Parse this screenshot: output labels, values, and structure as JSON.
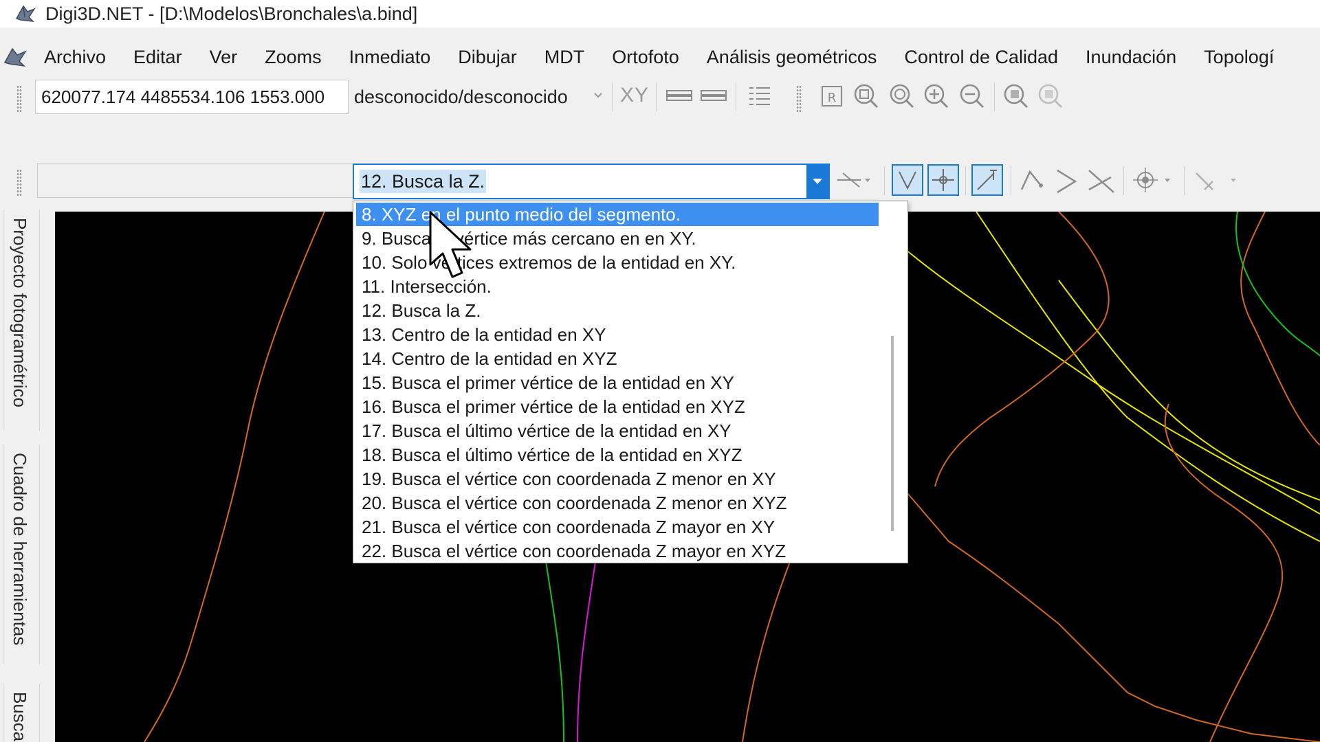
{
  "window": {
    "title": "Digi3D.NET - [D:\\Modelos\\Bronchales\\a.bind]"
  },
  "menu": {
    "items": [
      "Archivo",
      "Editar",
      "Ver",
      "Zooms",
      "Inmediato",
      "Dibujar",
      "MDT",
      "Ortofoto",
      "Análisis geométricos",
      "Control de Calidad",
      "Inundación",
      "Topologí"
    ]
  },
  "toolbar": {
    "coordinates_value": "620077.174 4485534.106 1553.000",
    "crs_value": "desconocido/desconocido",
    "xy_label": "XY"
  },
  "snap": {
    "selected": "12. Busca la Z.",
    "highlighted_index": 0,
    "options": [
      "8. XYZ en el punto medio del segmento.",
      "9. Busca el vértice más cercano en en XY.",
      "10. Solo vértices extremos de la entidad en XY.",
      "11. Intersección.",
      "12. Busca la Z.",
      "13. Centro de la entidad en XY",
      "14. Centro de la entidad en XYZ",
      "15. Busca el primer vértice de la entidad en XY",
      "16. Busca el primer vértice de la entidad en XYZ",
      "17. Busca el último vértice de la entidad en XY",
      "18. Busca el último vértice de la entidad en XYZ",
      "19. Busca el vértice con coordenada Z menor en XY",
      "20. Busca el vértice con coordenada Z menor en XYZ",
      "21. Busca el vértice con coordenada Z mayor en XY",
      "22. Busca el vértice con coordenada Z mayor en XYZ"
    ]
  },
  "side_panels": {
    "tabs": [
      "Proyecto fotogramétrico",
      "Cuadro de herramientas",
      "Busca"
    ]
  },
  "colors": {
    "accent": "#1a78d6",
    "highlight": "#3d8ff0",
    "canvas_background": "#000000",
    "contour_orange": "#d2691e",
    "contour_yellow": "#e6e600",
    "contour_green": "#19c219",
    "contour_magenta": "#d81ad8"
  }
}
